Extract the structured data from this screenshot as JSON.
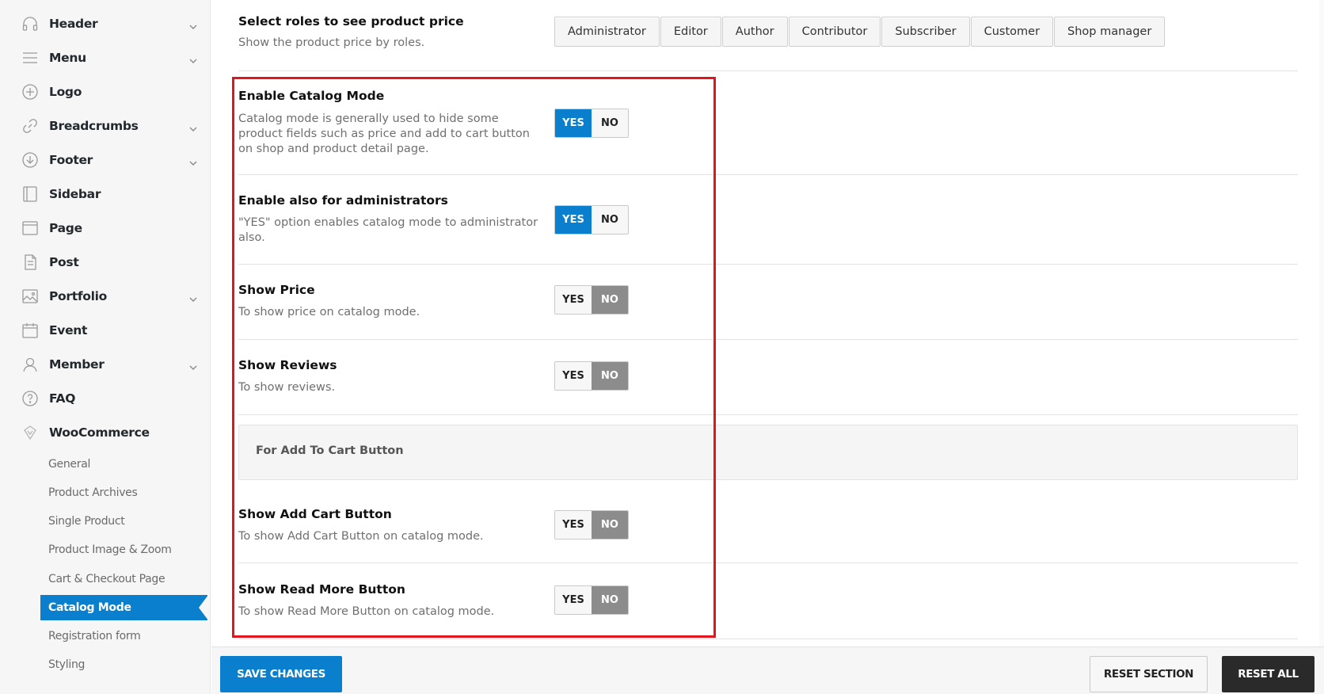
{
  "sidebar": {
    "items": [
      {
        "label": "Header",
        "icon": "headphones-icon",
        "chevron": true
      },
      {
        "label": "Menu",
        "icon": "menu-icon",
        "chevron": true
      },
      {
        "label": "Logo",
        "icon": "plus-circle-icon",
        "chevron": false
      },
      {
        "label": "Breadcrumbs",
        "icon": "link-icon",
        "chevron": true
      },
      {
        "label": "Footer",
        "icon": "arrow-down-circle-icon",
        "chevron": true
      },
      {
        "label": "Sidebar",
        "icon": "sidebar-icon",
        "chevron": false
      },
      {
        "label": "Page",
        "icon": "page-icon",
        "chevron": false
      },
      {
        "label": "Post",
        "icon": "post-icon",
        "chevron": false
      },
      {
        "label": "Portfolio",
        "icon": "image-icon",
        "chevron": true
      },
      {
        "label": "Event",
        "icon": "calendar-icon",
        "chevron": false
      },
      {
        "label": "Member",
        "icon": "user-icon",
        "chevron": true
      },
      {
        "label": "FAQ",
        "icon": "question-circle-icon",
        "chevron": false
      },
      {
        "label": "WooCommerce",
        "icon": "woocommerce-icon",
        "chevron": false
      }
    ],
    "woo_sub": [
      {
        "label": "General",
        "active": false
      },
      {
        "label": "Product Archives",
        "active": false
      },
      {
        "label": "Single Product",
        "active": false
      },
      {
        "label": "Product Image & Zoom",
        "active": false
      },
      {
        "label": "Cart & Checkout Page",
        "active": false
      },
      {
        "label": "Catalog Mode",
        "active": true
      },
      {
        "label": "Registration form",
        "active": false
      },
      {
        "label": "Styling",
        "active": false
      }
    ]
  },
  "main": {
    "roles_row": {
      "title": "Select roles to see product price",
      "desc": "Show the product price by roles.",
      "roles": [
        "Administrator",
        "Editor",
        "Author",
        "Contributor",
        "Subscriber",
        "Customer",
        "Shop manager"
      ]
    },
    "settings": [
      {
        "title": "Enable Catalog Mode",
        "desc": "Catalog mode is generally used to hide some product fields such as price and add to cart button on shop and product detail page.",
        "value": "YES"
      },
      {
        "title": "Enable also for administrators",
        "desc": "\"YES\" option enables catalog mode to administrator also.",
        "value": "YES"
      },
      {
        "title": "Show Price",
        "desc": "To show price on catalog mode.",
        "value": "NO"
      },
      {
        "title": "Show Reviews",
        "desc": "To show reviews.",
        "value": "NO"
      }
    ],
    "section_heading": "For Add To Cart Button",
    "settings2": [
      {
        "title": "Show Add Cart Button",
        "desc": "To show Add Cart Button on catalog mode.",
        "value": "NO"
      },
      {
        "title": "Show Read More Button",
        "desc": "To show Read More Button on catalog mode.",
        "value": "NO"
      }
    ],
    "toggle_labels": {
      "yes": "YES",
      "no": "NO"
    }
  },
  "footer": {
    "save": "SAVE CHANGES",
    "reset_section": "RESET SECTION",
    "reset_all": "RESET ALL"
  },
  "colors": {
    "accent": "#0a7fcd",
    "highlight": "#e0151d",
    "no_active": "#8c8c8c",
    "dark_button": "#2a2a2a"
  }
}
